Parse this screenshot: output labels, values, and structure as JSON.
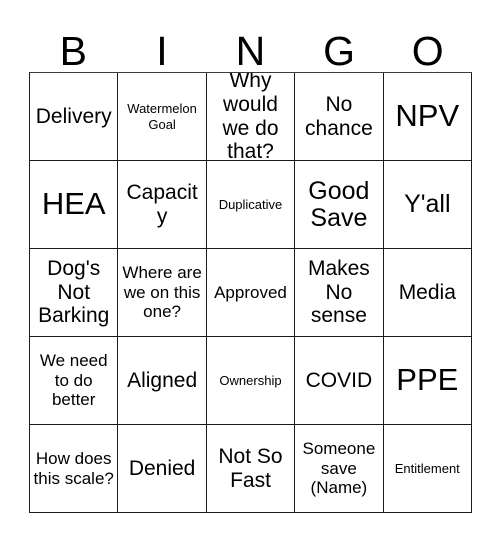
{
  "header": {
    "letters": [
      "B",
      "I",
      "N",
      "G",
      "O"
    ]
  },
  "grid": {
    "columns": 5,
    "rows": 5,
    "cells": [
      {
        "text": "Delivery",
        "size": "md"
      },
      {
        "text": "Watermelon Goal",
        "size": "xs"
      },
      {
        "text": "Why would we do that?",
        "size": "md"
      },
      {
        "text": "No chance",
        "size": "md"
      },
      {
        "text": "NPV",
        "size": "xl"
      },
      {
        "text": "HEA",
        "size": "xl"
      },
      {
        "text": "Capacity",
        "size": "md"
      },
      {
        "text": "Duplicative",
        "size": "xs"
      },
      {
        "text": "Good Save",
        "size": "lg"
      },
      {
        "text": "Y'all",
        "size": "lg"
      },
      {
        "text": "Dog's Not Barking",
        "size": "md"
      },
      {
        "text": "Where are we on this one?",
        "size": "sm"
      },
      {
        "text": "Approved",
        "size": "sm"
      },
      {
        "text": "Makes No sense",
        "size": "md"
      },
      {
        "text": "Media",
        "size": "md"
      },
      {
        "text": "We need to do better",
        "size": "sm"
      },
      {
        "text": "Aligned",
        "size": "md"
      },
      {
        "text": "Ownership",
        "size": "xs"
      },
      {
        "text": "COVID",
        "size": "md"
      },
      {
        "text": "PPE",
        "size": "xl"
      },
      {
        "text": "How does this scale?",
        "size": "sm"
      },
      {
        "text": "Denied",
        "size": "md"
      },
      {
        "text": "Not So Fast",
        "size": "md"
      },
      {
        "text": "Someone save (Name)",
        "size": "sm"
      },
      {
        "text": "Entitlement",
        "size": "xs"
      }
    ]
  }
}
